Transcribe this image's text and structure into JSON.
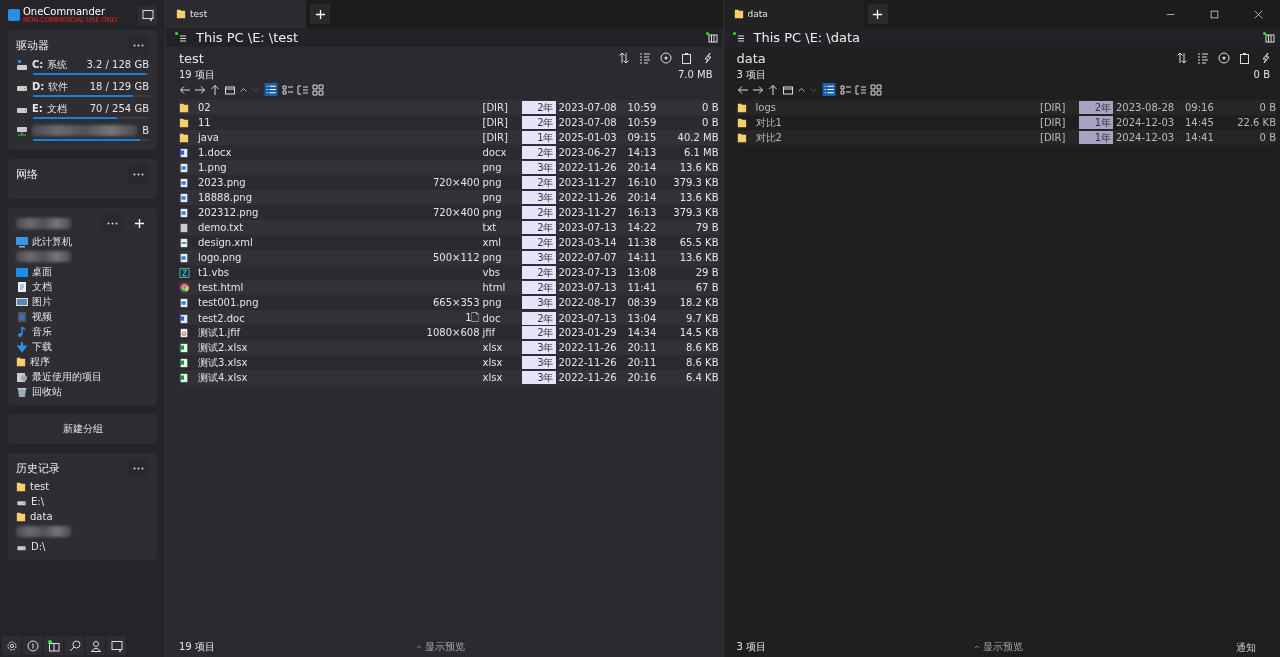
{
  "app": {
    "name": "OneCommander",
    "license": "NON-COMMERCIAL USE ONLY"
  },
  "drives": {
    "title": "驱动器",
    "items": [
      {
        "letter": "C:",
        "label": "系统",
        "usage": "3.2 / 128 GB",
        "level": 0.97,
        "kind": "system"
      },
      {
        "letter": "D:",
        "label": "软件",
        "usage": "18 / 129 GB",
        "level": 0.86,
        "kind": "disk"
      },
      {
        "letter": "E:",
        "label": "文档",
        "usage": "70 / 254 GB",
        "level": 0.72,
        "kind": "disk"
      },
      {
        "usage": "B",
        "level": 0.92,
        "kind": "network"
      }
    ]
  },
  "network": {
    "title": "网络"
  },
  "places": {
    "items": [
      {
        "label": "此计算机",
        "kind": "computer"
      },
      {
        "kind": "blurred"
      },
      {
        "label": "桌面",
        "kind": "desktop"
      },
      {
        "label": "文档",
        "kind": "documents"
      },
      {
        "label": "图片",
        "kind": "pictures"
      },
      {
        "label": "视频",
        "kind": "videos"
      },
      {
        "label": "音乐",
        "kind": "music"
      },
      {
        "label": "下载",
        "kind": "downloads"
      },
      {
        "label": "程序",
        "kind": "folder"
      },
      {
        "label": "最近使用的项目",
        "kind": "recent"
      },
      {
        "label": "回收站",
        "kind": "recycle"
      }
    ]
  },
  "new_group": "新建分组",
  "history": {
    "title": "历史记录",
    "items": [
      {
        "label": "test",
        "kind": "folder"
      },
      {
        "label": "E:\\",
        "kind": "drive"
      },
      {
        "label": "data",
        "kind": "folder"
      },
      {
        "kind": "blurred"
      },
      {
        "label": "D:\\",
        "kind": "drive"
      }
    ]
  },
  "panes": [
    {
      "active": true,
      "tab": "test",
      "path": "This PC \\E: \\test",
      "folder": "test",
      "count": "19 项目",
      "total": "7.0 MB",
      "footer_count": "19 项目",
      "preview": "显示预览",
      "rows": [
        {
          "name": "02",
          "kind": "folder",
          "dims": "",
          "ext": "[DIR]",
          "age": "2年",
          "date": "2023-07-08",
          "time": "10:59",
          "size": "0 B"
        },
        {
          "name": "11",
          "kind": "folder",
          "dims": "",
          "ext": "[DIR]",
          "age": "2年",
          "date": "2023-07-08",
          "time": "10:59",
          "size": "0 B"
        },
        {
          "name": "java",
          "kind": "folder",
          "dims": "",
          "ext": "[DIR]",
          "age": "1年",
          "date": "2025-01-03",
          "time": "09:15",
          "size": "40.2 MB"
        },
        {
          "name": "1.docx",
          "kind": "word",
          "dims": "",
          "ext": "docx",
          "age": "2年",
          "date": "2023-06-27",
          "time": "14:13",
          "size": "6.1 MB"
        },
        {
          "name": "1.png",
          "kind": "image",
          "dims": "",
          "ext": "png",
          "age": "3年",
          "date": "2022-11-26",
          "time": "20:14",
          "size": "13.6 KB"
        },
        {
          "name": "2023.png",
          "kind": "image",
          "dims": "720×400",
          "ext": "png",
          "age": "2年",
          "date": "2023-11-27",
          "time": "16:10",
          "size": "379.3 KB"
        },
        {
          "name": "18888.png",
          "kind": "image",
          "dims": "",
          "ext": "png",
          "age": "3年",
          "date": "2022-11-26",
          "time": "20:14",
          "size": "13.6 KB"
        },
        {
          "name": "202312.png",
          "kind": "image",
          "dims": "720×400",
          "ext": "png",
          "age": "2年",
          "date": "2023-11-27",
          "time": "16:13",
          "size": "379.3 KB"
        },
        {
          "name": "demo.txt",
          "kind": "text",
          "dims": "",
          "ext": "txt",
          "age": "2年",
          "date": "2023-07-13",
          "time": "14:22",
          "size": "79 B"
        },
        {
          "name": "design.xml",
          "kind": "xml",
          "dims": "",
          "ext": "xml",
          "age": "2年",
          "date": "2023-03-14",
          "time": "11:38",
          "size": "65.5 KB"
        },
        {
          "name": "logo.png",
          "kind": "image",
          "dims": "500×112",
          "ext": "png",
          "age": "3年",
          "date": "2022-07-07",
          "time": "14:11",
          "size": "13.6 KB"
        },
        {
          "name": "t1.vbs",
          "kind": "script",
          "dims": "",
          "ext": "vbs",
          "age": "2年",
          "date": "2023-07-13",
          "time": "13:08",
          "size": "29 B"
        },
        {
          "name": "test.html",
          "kind": "web",
          "dims": "",
          "ext": "html",
          "age": "2年",
          "date": "2023-07-13",
          "time": "11:41",
          "size": "67 B"
        },
        {
          "name": "test001.png",
          "kind": "image",
          "dims": "665×353",
          "ext": "png",
          "age": "3年",
          "date": "2022-08-17",
          "time": "08:39",
          "size": "18.2 KB"
        },
        {
          "name": "test2.doc",
          "kind": "word",
          "dims": "1🗋",
          "ext": "doc",
          "age": "2年",
          "date": "2023-07-13",
          "time": "13:04",
          "size": "9.7 KB"
        },
        {
          "name": "测试1.jfif",
          "kind": "photo",
          "dims": "1080×608",
          "ext": "jfif",
          "age": "2年",
          "date": "2023-01-29",
          "time": "14:34",
          "size": "14.5 KB"
        },
        {
          "name": "测试2.xlsx",
          "kind": "sheet",
          "dims": "",
          "ext": "xlsx",
          "age": "3年",
          "date": "2022-11-26",
          "time": "20:11",
          "size": "8.6 KB"
        },
        {
          "name": "测试3.xlsx",
          "kind": "sheet",
          "dims": "",
          "ext": "xlsx",
          "age": "3年",
          "date": "2022-11-26",
          "time": "20:11",
          "size": "8.6 KB"
        },
        {
          "name": "测试4.xlsx",
          "kind": "sheet",
          "dims": "",
          "ext": "xlsx",
          "age": "3年",
          "date": "2022-11-26",
          "time": "20:16",
          "size": "6.4 KB"
        }
      ]
    },
    {
      "active": false,
      "tab": "data",
      "path": "This PC \\E: \\data",
      "folder": "data",
      "count": "3 项目",
      "total": "0 B",
      "footer_count": "3 项目",
      "preview": "显示预览",
      "rows": [
        {
          "name": "logs",
          "kind": "folder",
          "dims": "",
          "ext": "[DIR]",
          "age": "2年",
          "date": "2023-08-28",
          "time": "09:16",
          "size": "0 B"
        },
        {
          "name": "对比1",
          "kind": "folder",
          "dims": "",
          "ext": "[DIR]",
          "age": "1年",
          "date": "2024-12-03",
          "time": "14:45",
          "size": "22.6 KB"
        },
        {
          "name": "对比2",
          "kind": "folder",
          "dims": "",
          "ext": "[DIR]",
          "age": "1年",
          "date": "2024-12-03",
          "time": "14:41",
          "size": "0 B"
        }
      ]
    }
  ],
  "notification": "通知"
}
